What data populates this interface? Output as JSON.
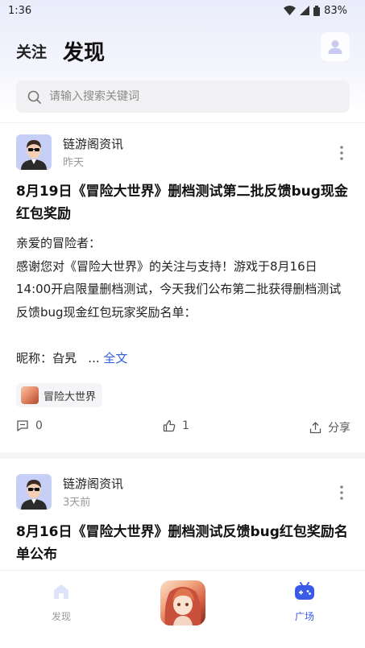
{
  "status": {
    "time": "1:36",
    "battery": "83%"
  },
  "header": {
    "tab_follow": "关注",
    "tab_discover": "发现"
  },
  "search": {
    "placeholder": "请输入搜索关键词"
  },
  "posts": [
    {
      "author": "链游阁资讯",
      "time": "昨天",
      "title": "8月19日《冒险大世界》删档测试第二批反馈bug现金红包奖励",
      "body": "亲爱的冒险者：\n感谢您对《冒险大世界》的关注与支持！游戏于8月16日14:00开启限量删档测试，今天我们公布第二批获得删档测试反馈bug现金红包玩家奖励名单：\n\n昵称：旮旯   ... ",
      "more_link": "全文",
      "tag": "冒险大世界",
      "comments": "0",
      "likes": "1",
      "share_label": "分享"
    },
    {
      "author": "链游阁资讯",
      "time": "3天前",
      "title": "8月16日《冒险大世界》删档测试反馈bug红包奖励名单公布"
    }
  ],
  "nav": {
    "discover_label": "发现",
    "square_label": "广场"
  },
  "colors": {
    "accent": "#2f5fd6",
    "nav_active": "#3a5ae8"
  }
}
